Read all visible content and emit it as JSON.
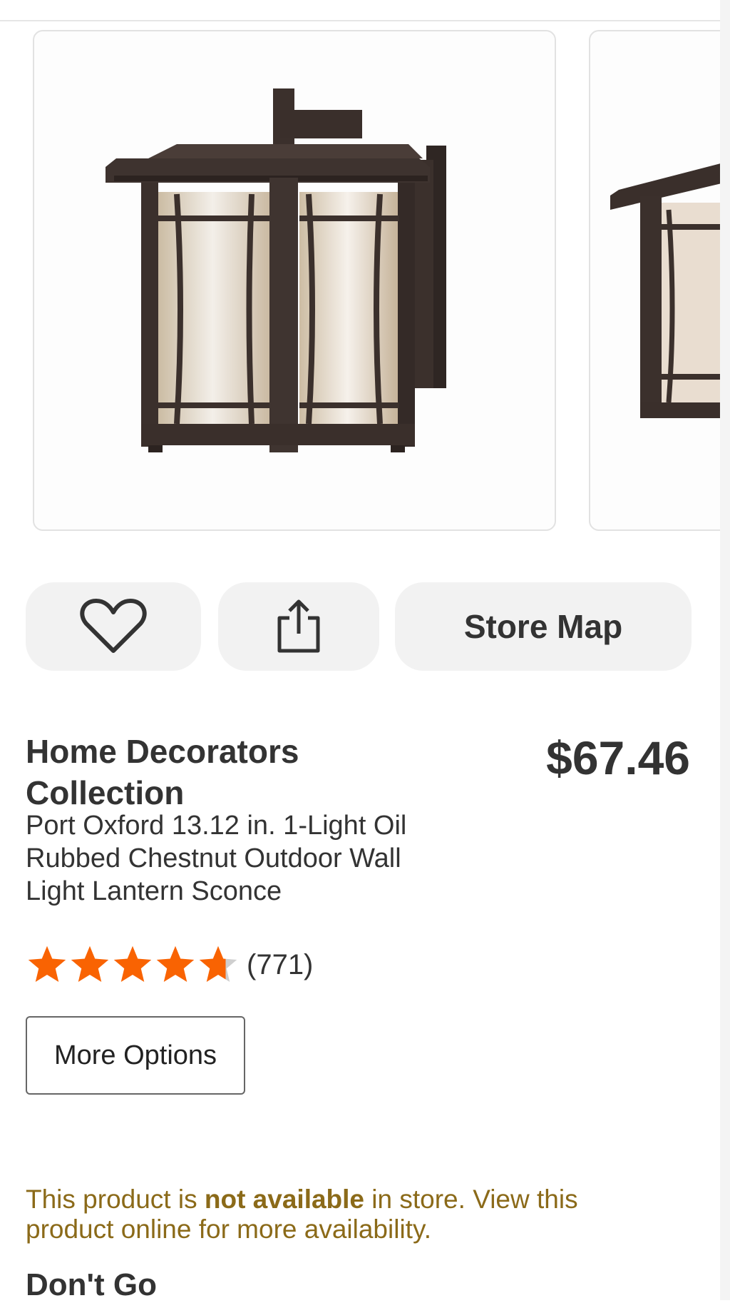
{
  "product": {
    "brand": "Home Decorators Collection",
    "title": "Port Oxford 13.12 in. 1-Light Oil Rubbed Chestnut Outdoor Wall Light Lantern Sconce",
    "price": "$67.46"
  },
  "actions": {
    "favorite_icon": "heart-icon",
    "share_icon": "share-icon",
    "store_map_label": "Store Map"
  },
  "rating": {
    "value": 4.7,
    "max": 5,
    "review_count": "(771)",
    "star_color": "#f96302",
    "empty_color": "#cfcfcf"
  },
  "more_options_label": "More Options",
  "availability": {
    "prefix": "This product is ",
    "emphasis": "not available",
    "suffix": " in store. View this product online for more availability.",
    "color": "#8b6a19"
  },
  "next_section_heading": "Don't Go"
}
